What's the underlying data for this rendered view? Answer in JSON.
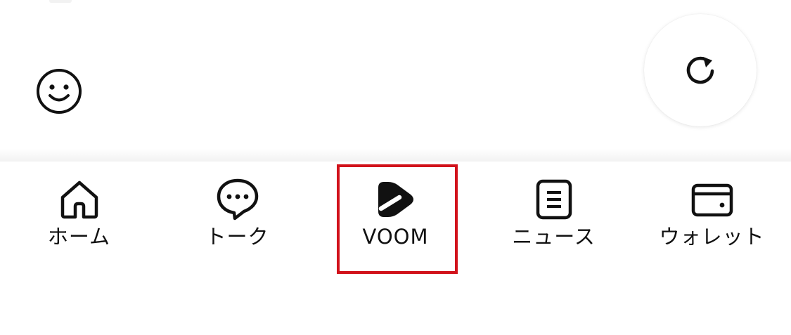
{
  "colors": {
    "background": "#ffffff",
    "icon": "#111111",
    "highlight": "#d1121b",
    "divider": "#f2f2f2"
  },
  "icons": {
    "emoji": "smiley-face-icon",
    "refresh": "refresh-icon"
  },
  "tabbar": {
    "tabs": [
      {
        "id": "home",
        "label": "ホーム",
        "icon": "home-icon"
      },
      {
        "id": "talk",
        "label": "トーク",
        "icon": "chat-bubble-icon"
      },
      {
        "id": "voom",
        "label": "VOOM",
        "icon": "voom-play-icon",
        "highlighted": true
      },
      {
        "id": "news",
        "label": "ニュース",
        "icon": "news-document-icon"
      },
      {
        "id": "wallet",
        "label": "ウォレット",
        "icon": "wallet-icon"
      }
    ]
  }
}
